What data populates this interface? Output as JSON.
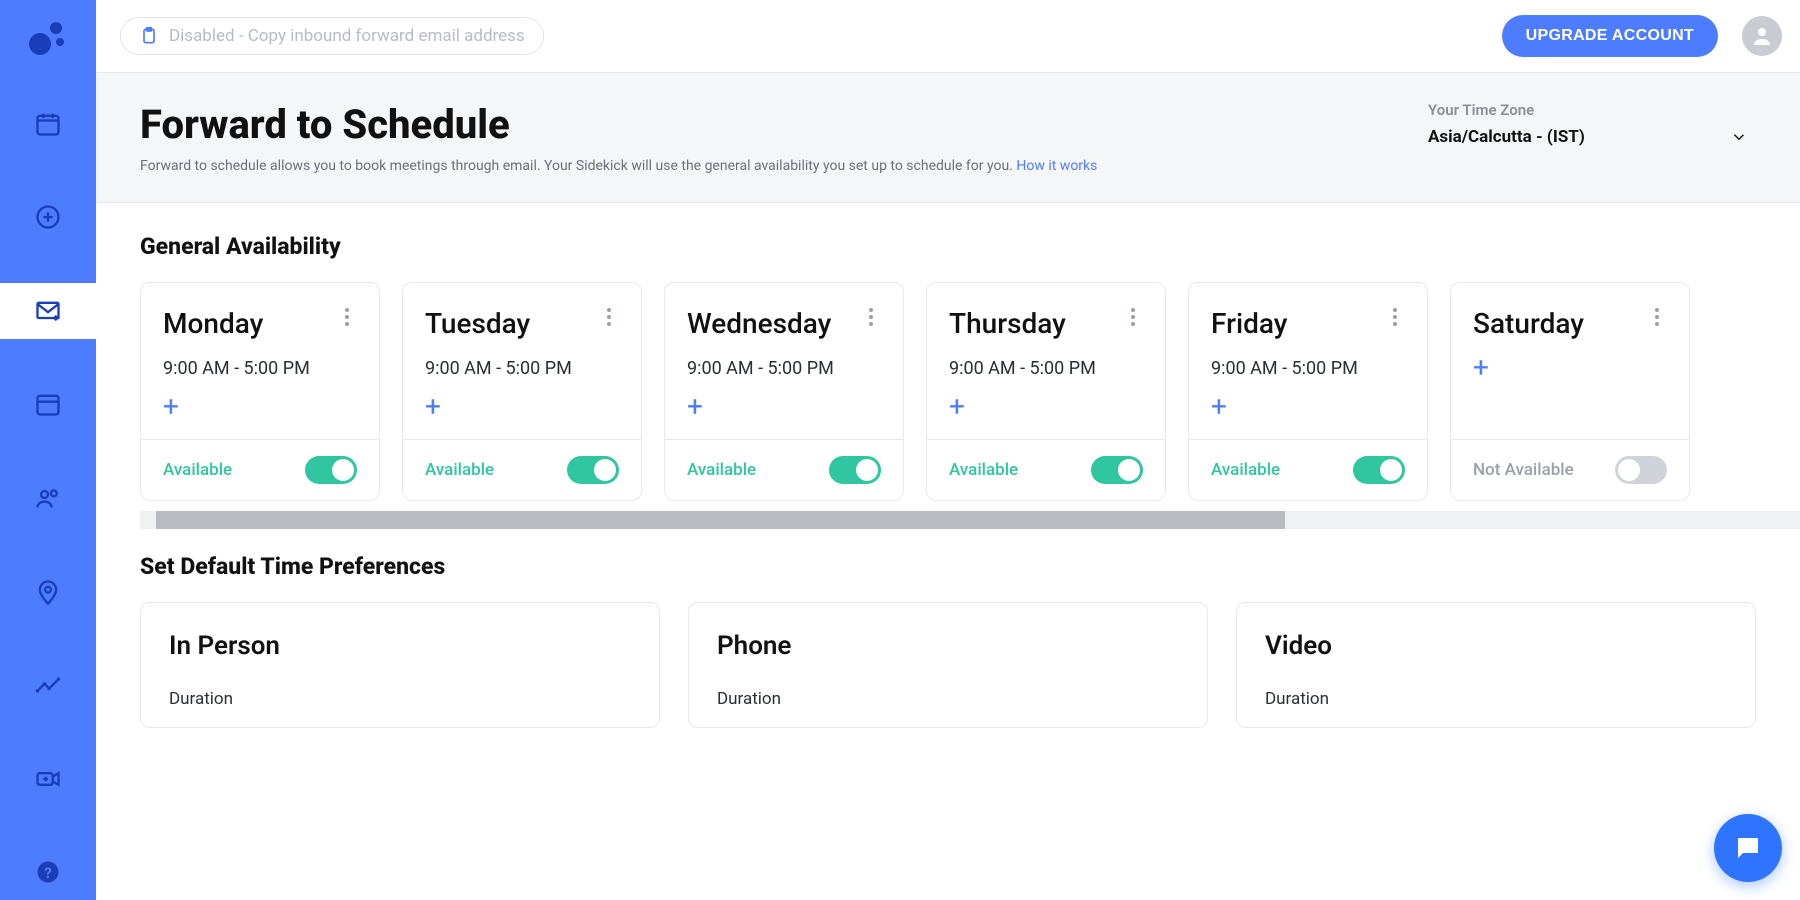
{
  "topbar": {
    "copy_hint": "Disabled - Copy inbound forward email address",
    "upgrade_label": "UPGRADE ACCOUNT"
  },
  "hero": {
    "title": "Forward to Schedule",
    "subtitle_pre": "Forward to schedule allows you to book meetings through email. Your Sidekick will use the general availability you set up to schedule for you. ",
    "how_link": "How it works",
    "tz_label": "Your Time Zone",
    "tz_value": "Asia/Calcutta - (IST)"
  },
  "availability": {
    "section_title": "General Availability",
    "available_label": "Available",
    "not_available_label": "Not Available",
    "days": [
      {
        "name": "Monday",
        "range": "9:00 AM - 5:00 PM",
        "available": true
      },
      {
        "name": "Tuesday",
        "range": "9:00 AM - 5:00 PM",
        "available": true
      },
      {
        "name": "Wednesday",
        "range": "9:00 AM - 5:00 PM",
        "available": true
      },
      {
        "name": "Thursday",
        "range": "9:00 AM - 5:00 PM",
        "available": true
      },
      {
        "name": "Friday",
        "range": "9:00 AM - 5:00 PM",
        "available": true
      },
      {
        "name": "Saturday",
        "range": "",
        "available": false
      }
    ]
  },
  "prefs": {
    "section_title": "Set Default Time Preferences",
    "duration_label": "Duration",
    "cards": [
      {
        "title": "In Person"
      },
      {
        "title": "Phone"
      },
      {
        "title": "Video"
      }
    ]
  }
}
